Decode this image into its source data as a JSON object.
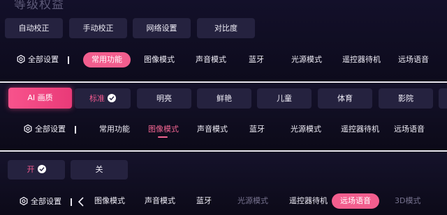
{
  "panel1": {
    "title": "等级权益",
    "chips": [
      {
        "label": "自动校正"
      },
      {
        "label": "手动校正"
      },
      {
        "label": "网络设置"
      },
      {
        "label": "对比度"
      }
    ],
    "all_settings": "全部设置",
    "tabs": [
      {
        "label": "常用功能",
        "state": "active-pill"
      },
      {
        "label": "图像模式"
      },
      {
        "label": "声音模式"
      },
      {
        "label": "蓝牙"
      },
      {
        "label": "光源模式"
      },
      {
        "label": "遥控器待机"
      },
      {
        "label": "远场语音"
      }
    ]
  },
  "panel2": {
    "chips": [
      {
        "label": "AI 画质",
        "state": "active"
      },
      {
        "label": "标准",
        "state": "selected"
      },
      {
        "label": "明亮"
      },
      {
        "label": "鲜艳"
      },
      {
        "label": "儿童"
      },
      {
        "label": "体育"
      },
      {
        "label": "影院"
      }
    ],
    "all_settings": "全部设置",
    "tabs": [
      {
        "label": "常用功能"
      },
      {
        "label": "图像模式",
        "state": "focused"
      },
      {
        "label": "声音模式"
      },
      {
        "label": "蓝牙"
      },
      {
        "label": "光源模式"
      },
      {
        "label": "遥控器待机"
      },
      {
        "label": "远场语音"
      }
    ]
  },
  "panel3": {
    "chips": [
      {
        "label": "开",
        "state": "selected"
      },
      {
        "label": "关"
      }
    ],
    "all_settings": "全部设置",
    "tabs": [
      {
        "label": "图像模式"
      },
      {
        "label": "声音模式"
      },
      {
        "label": "蓝牙"
      },
      {
        "label": "光源模式",
        "state": "dim"
      },
      {
        "label": "遥控器待机"
      },
      {
        "label": "远场语音",
        "state": "active-pill"
      },
      {
        "label": "3D模式",
        "state": "dim"
      }
    ]
  },
  "colors": {
    "accent_pink": "#f25e8e",
    "chip_bg": "#25223f",
    "background": "#0f0c1c"
  }
}
